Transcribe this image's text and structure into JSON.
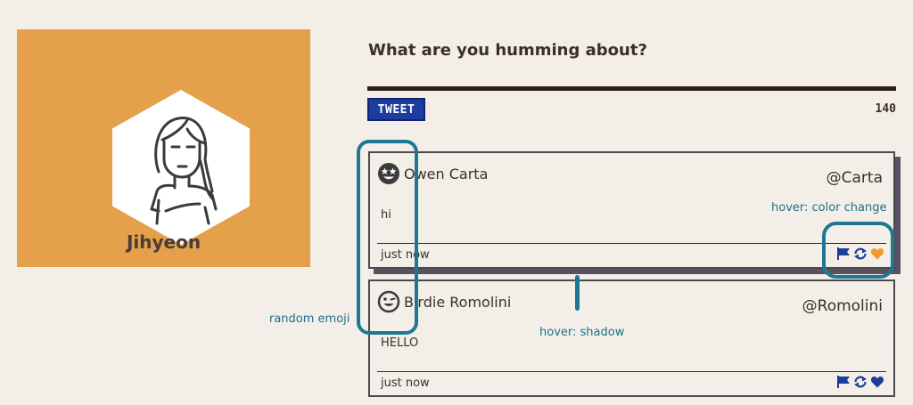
{
  "profile": {
    "name": "Jihyeon"
  },
  "composer": {
    "prompt": "What are you humming about?",
    "tweet_button": "TWEET",
    "char_count": "140"
  },
  "tweets": [
    {
      "author": "Owen Carta",
      "handle": "@Carta",
      "message": "hi",
      "time": "just now",
      "emoji": "star-eyes-emoji",
      "heart_color": "#f29a26"
    },
    {
      "author": "Birdie Romolini",
      "handle": "@Romolini",
      "message": "HELLO",
      "time": "just now",
      "emoji": "wink-emoji",
      "heart_color": "#1d3c9c"
    }
  ],
  "annotations": {
    "hover_color": "hover: color change",
    "random_emoji": "random emoji",
    "hover_shadow": "hover: shadow"
  },
  "colors": {
    "accent": "#1d3c9c",
    "profile_bg": "#e4a04a",
    "annotation": "#1f7893"
  }
}
